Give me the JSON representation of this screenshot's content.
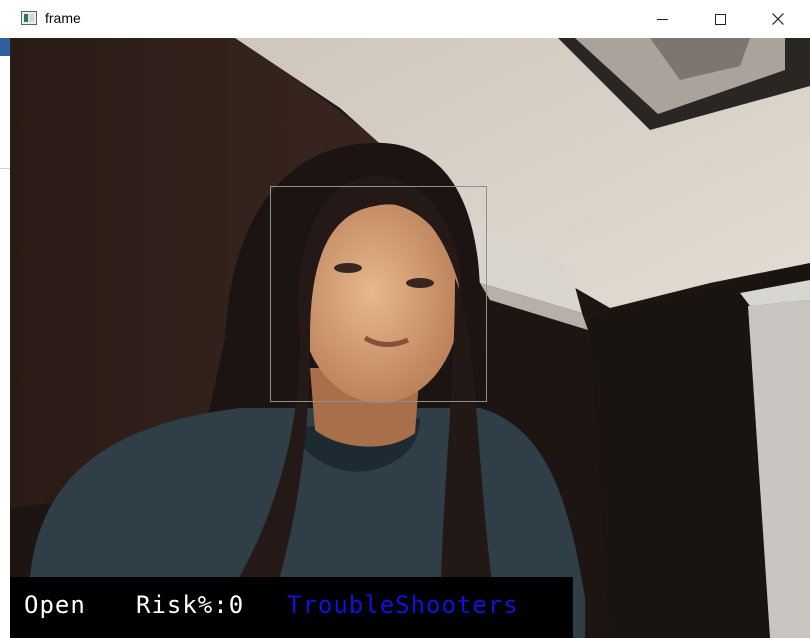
{
  "window": {
    "title": "frame",
    "controls": {
      "minimize": "minimize",
      "maximize": "maximize",
      "close": "close"
    }
  },
  "overlay": {
    "status": "Open",
    "risk": "Risk%:0",
    "brand": "TroubleShooters"
  },
  "colors": {
    "banner": "#000000",
    "status_text": "#ffffff",
    "brand_text": "#1010e0",
    "face_box": "#8f8f8f"
  }
}
